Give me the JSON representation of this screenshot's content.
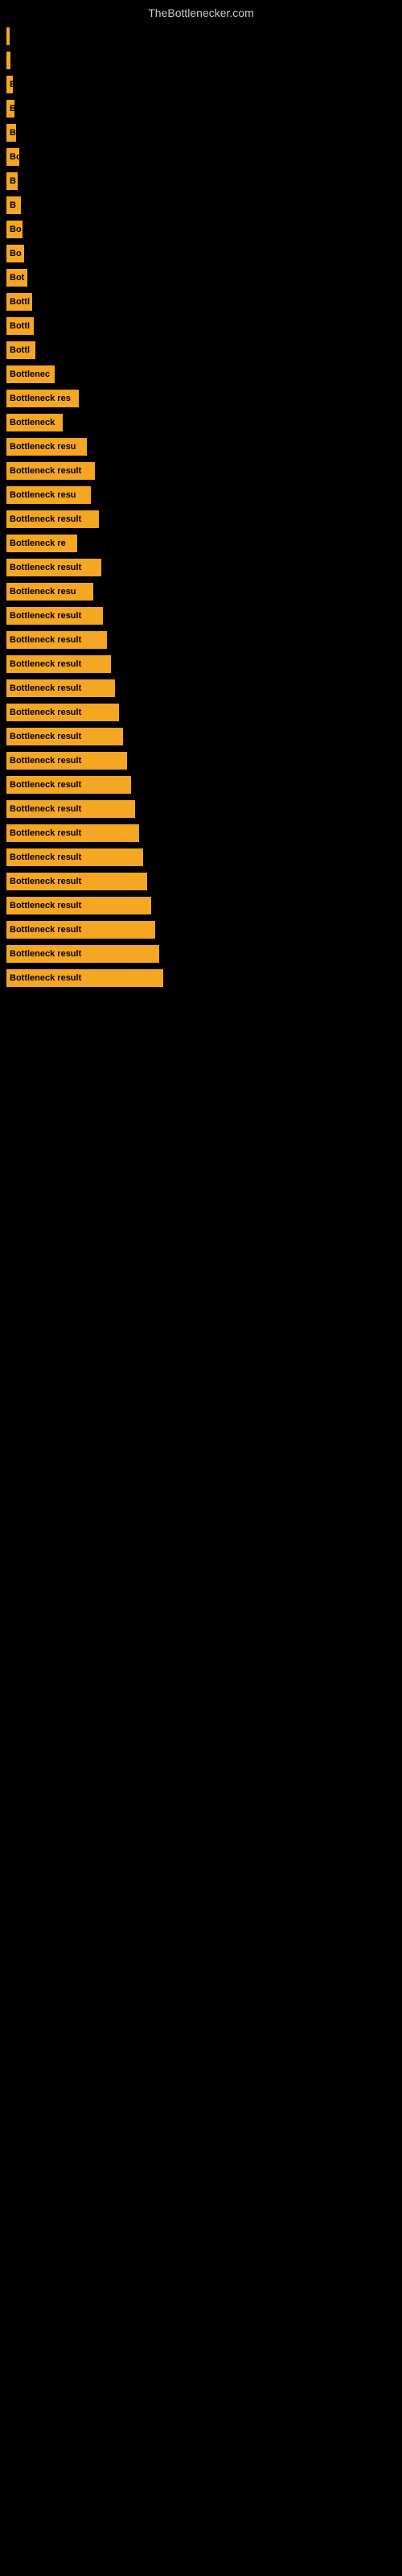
{
  "site": {
    "title": "TheBottlenecker.com"
  },
  "bars": [
    {
      "label": "",
      "width": 4
    },
    {
      "label": "",
      "width": 5
    },
    {
      "label": "E",
      "width": 8
    },
    {
      "label": "B",
      "width": 10
    },
    {
      "label": "B",
      "width": 12
    },
    {
      "label": "Bo",
      "width": 16
    },
    {
      "label": "B",
      "width": 14
    },
    {
      "label": "B",
      "width": 18
    },
    {
      "label": "Bo",
      "width": 20
    },
    {
      "label": "Bo",
      "width": 22
    },
    {
      "label": "Bot",
      "width": 26
    },
    {
      "label": "Bottl",
      "width": 32
    },
    {
      "label": "Bottl",
      "width": 34
    },
    {
      "label": "Bottl",
      "width": 36
    },
    {
      "label": "Bottlenec",
      "width": 60
    },
    {
      "label": "Bottleneck res",
      "width": 90
    },
    {
      "label": "Bottleneck",
      "width": 70
    },
    {
      "label": "Bottleneck resu",
      "width": 100
    },
    {
      "label": "Bottleneck result",
      "width": 110
    },
    {
      "label": "Bottleneck resu",
      "width": 105
    },
    {
      "label": "Bottleneck result",
      "width": 115
    },
    {
      "label": "Bottleneck re",
      "width": 88
    },
    {
      "label": "Bottleneck result",
      "width": 118
    },
    {
      "label": "Bottleneck resu",
      "width": 108
    },
    {
      "label": "Bottleneck result",
      "width": 120
    },
    {
      "label": "Bottleneck result",
      "width": 125
    },
    {
      "label": "Bottleneck result",
      "width": 130
    },
    {
      "label": "Bottleneck result",
      "width": 135
    },
    {
      "label": "Bottleneck result",
      "width": 140
    },
    {
      "label": "Bottleneck result",
      "width": 145
    },
    {
      "label": "Bottleneck result",
      "width": 150
    },
    {
      "label": "Bottleneck result",
      "width": 155
    },
    {
      "label": "Bottleneck result",
      "width": 160
    },
    {
      "label": "Bottleneck result",
      "width": 165
    },
    {
      "label": "Bottleneck result",
      "width": 170
    },
    {
      "label": "Bottleneck result",
      "width": 175
    },
    {
      "label": "Bottleneck result",
      "width": 180
    },
    {
      "label": "Bottleneck result",
      "width": 185
    },
    {
      "label": "Bottleneck result",
      "width": 190
    },
    {
      "label": "Bottleneck result",
      "width": 195
    }
  ]
}
